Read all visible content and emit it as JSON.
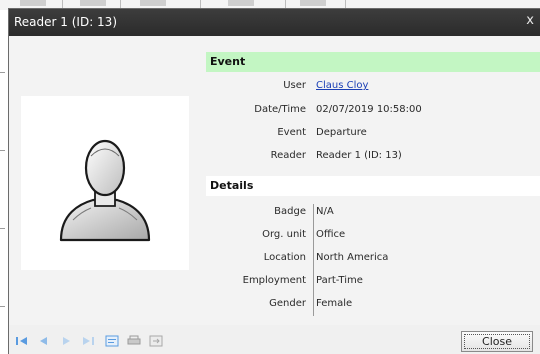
{
  "window": {
    "title": "Reader 1 (ID: 13)",
    "close_glyph": "x"
  },
  "photo": {
    "icon": "user-silhouette-icon"
  },
  "event": {
    "header": "Event",
    "fields": [
      {
        "label": "User",
        "value": "Claus Cloy"
      },
      {
        "label": "Date/Time",
        "value": "02/07/2019 10:58:00"
      },
      {
        "label": "Event",
        "value": "Departure"
      },
      {
        "label": "Reader",
        "value": "Reader 1 (ID: 13)"
      }
    ]
  },
  "details": {
    "header": "Details",
    "fields": [
      {
        "label": "Badge",
        "value": "N/A"
      },
      {
        "label": "Org. unit",
        "value": "Office"
      },
      {
        "label": "Location",
        "value": "North America"
      },
      {
        "label": "Employment",
        "value": "Part-Time"
      },
      {
        "label": "Gender",
        "value": "Female"
      }
    ]
  },
  "footer": {
    "nav_icons": [
      "first-record-icon",
      "previous-record-icon",
      "next-record-icon",
      "last-record-icon",
      "view-icon",
      "print-icon",
      "export-icon"
    ],
    "close_label": "Close"
  },
  "colors": {
    "titlebar": "#333333",
    "event_header_bg": "#c3f6c3",
    "link": "#1a3fb5",
    "nav_icon": "#4a90d9"
  }
}
